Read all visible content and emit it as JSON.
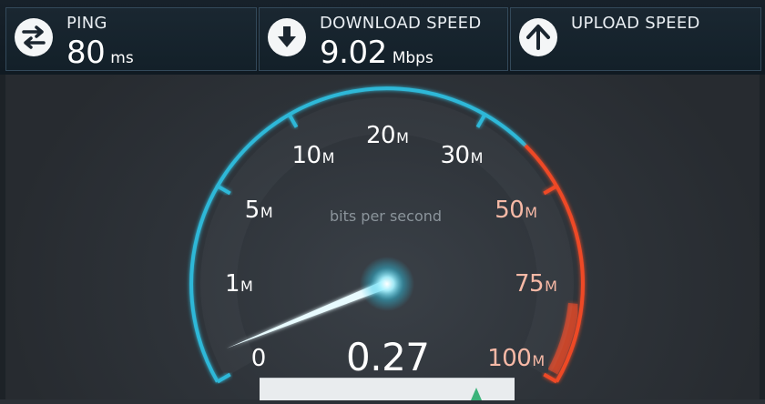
{
  "stats": {
    "ping": {
      "label": "PING",
      "value": "80",
      "unit": "ms",
      "icon": "ping-arrows-icon"
    },
    "download": {
      "label": "DOWNLOAD SPEED",
      "value": "9.02",
      "unit": "Mbps",
      "icon": "download-arrow-icon"
    },
    "upload": {
      "label": "UPLOAD SPEED",
      "value": "",
      "unit": "",
      "icon": "upload-arrow-icon"
    }
  },
  "gauge": {
    "caption": "bits per second",
    "current_reading": "0.27",
    "needle_value_mbps": 0.27,
    "scale_labels": [
      {
        "num": "0",
        "sfx": ""
      },
      {
        "num": "1",
        "sfx": "M"
      },
      {
        "num": "5",
        "sfx": "M"
      },
      {
        "num": "10",
        "sfx": "M"
      },
      {
        "num": "20",
        "sfx": "M"
      },
      {
        "num": "30",
        "sfx": "M"
      },
      {
        "num": "50",
        "sfx": "M"
      },
      {
        "num": "75",
        "sfx": "M"
      },
      {
        "num": "100",
        "sfx": "M"
      }
    ],
    "colors": {
      "normal_arc": "#2fb8d8",
      "high_arc": "#ee4a28",
      "high_label": "#f7b9a6",
      "needle": "#e8fbff"
    }
  }
}
